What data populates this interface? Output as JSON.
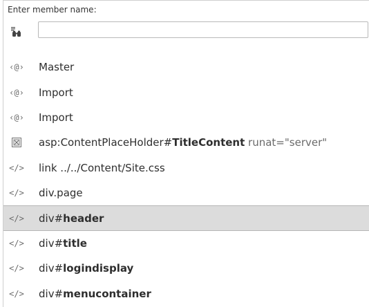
{
  "prompt": "Enter member name:",
  "search": {
    "value": ""
  },
  "items": [
    {
      "icon": "master-directive-icon",
      "glyph": "‹@›",
      "prefix": "Master",
      "bold": "",
      "suffix": "",
      "selected": false
    },
    {
      "icon": "import-directive-icon",
      "glyph": "‹@›",
      "prefix": "Import",
      "bold": "",
      "suffix": "",
      "selected": false
    },
    {
      "icon": "import-directive-icon",
      "glyph": "‹@›",
      "prefix": "Import",
      "bold": "",
      "suffix": "",
      "selected": false
    },
    {
      "icon": "server-control-icon",
      "glyph": "",
      "prefix": "asp:ContentPlaceHolder#",
      "bold": "TitleContent",
      "suffix": " runat=\"server\"",
      "selected": false
    },
    {
      "icon": "html-tag-icon",
      "glyph": "</>",
      "prefix": "link ../../Content/Site.css",
      "bold": "",
      "suffix": "",
      "selected": false
    },
    {
      "icon": "html-tag-icon",
      "glyph": "</>",
      "prefix": "div.page",
      "bold": "",
      "suffix": "",
      "selected": false
    },
    {
      "icon": "html-tag-icon",
      "glyph": "</>",
      "prefix": "div#",
      "bold": "header",
      "suffix": "",
      "selected": true
    },
    {
      "icon": "html-tag-icon",
      "glyph": "</>",
      "prefix": "div#",
      "bold": "title",
      "suffix": "",
      "selected": false
    },
    {
      "icon": "html-tag-icon",
      "glyph": "</>",
      "prefix": "div#",
      "bold": "logindisplay",
      "suffix": "",
      "selected": false
    },
    {
      "icon": "html-tag-icon",
      "glyph": "</>",
      "prefix": "div#",
      "bold": "menucontainer",
      "suffix": "",
      "selected": false
    }
  ]
}
